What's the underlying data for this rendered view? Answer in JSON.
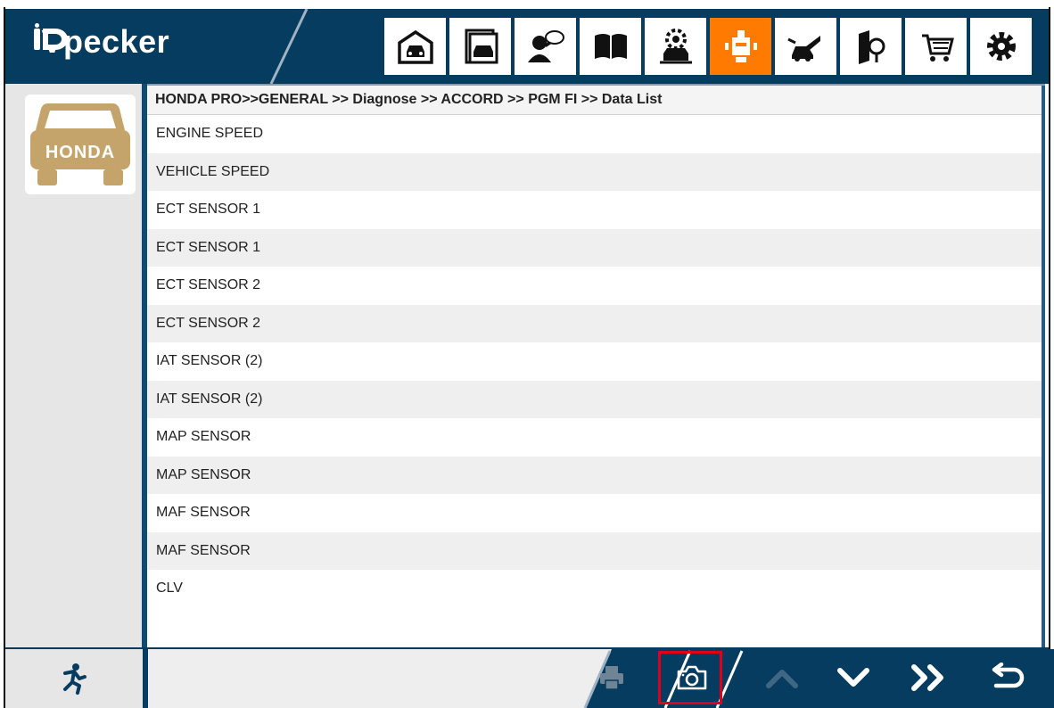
{
  "header": {
    "brand": "Vpecker",
    "nav_icons": [
      "garage-icon",
      "vehicle-list-icon",
      "consult-icon",
      "manual-icon",
      "service-icon",
      "diagnose-icon",
      "repair-icon",
      "library-icon",
      "shop-icon",
      "settings-icon"
    ],
    "active_index": 5,
    "colors": {
      "bar": "#063c5f",
      "active": "#ff7a00",
      "brand_car": "#c4a46a"
    }
  },
  "sidebar": {
    "make_label": "HONDA"
  },
  "breadcrumb": "HONDA PRO>>GENERAL >> Diagnose >> ACCORD >> PGM FI >> Data List",
  "rows": [
    "ENGINE SPEED",
    "VEHICLE SPEED",
    "ECT SENSOR 1",
    "ECT SENSOR 1",
    "ECT SENSOR 2",
    "ECT SENSOR 2",
    "IAT SENSOR (2)",
    "IAT SENSOR (2)",
    "MAP SENSOR",
    "MAP SENSOR",
    "MAF SENSOR",
    "MAF SENSOR",
    "CLV"
  ],
  "toolbar": {
    "icons": [
      "print-icon",
      "camera-icon",
      "scroll-up-icon",
      "scroll-down-icon",
      "page-forward-icon",
      "back-icon"
    ],
    "highlighted": "camera-icon"
  }
}
